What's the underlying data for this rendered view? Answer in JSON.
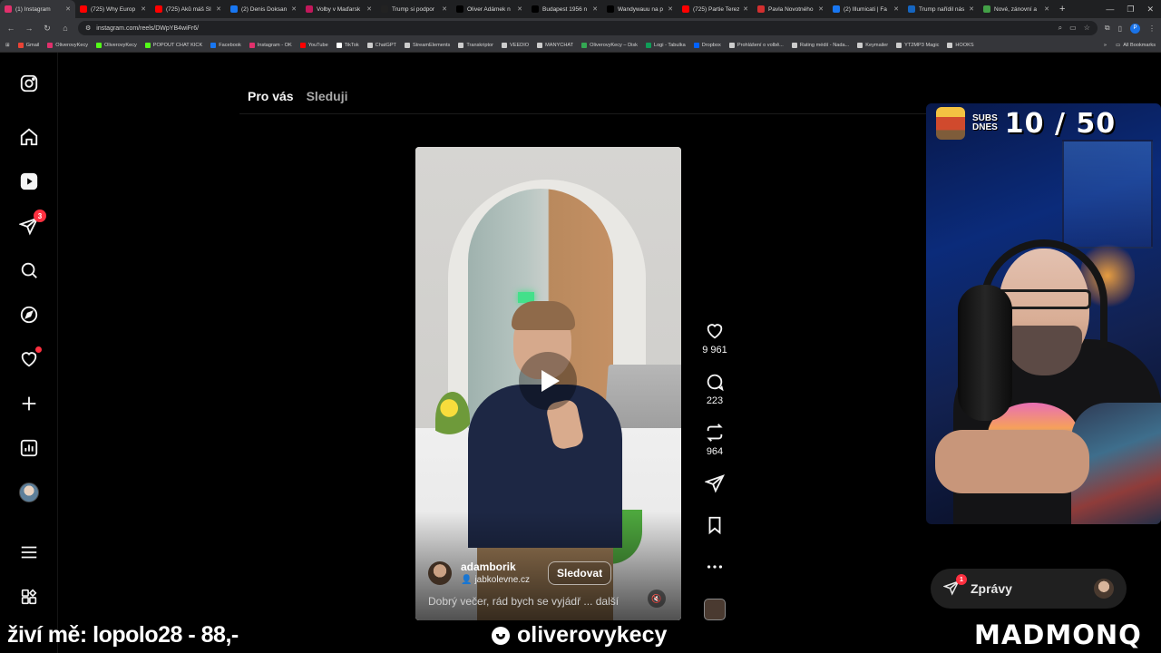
{
  "browser": {
    "tabs": [
      {
        "title": "(1) Instagram",
        "color": "#e1306c",
        "active": true
      },
      {
        "title": "(725) Why Europ",
        "color": "#ff0000"
      },
      {
        "title": "(725) Aků máš SI",
        "color": "#ff0000"
      },
      {
        "title": "(2) Denis Doksan",
        "color": "#1877f2"
      },
      {
        "title": "Volby v Maďarsk",
        "color": "#c2185b"
      },
      {
        "title": "Trump si podpor",
        "color": "#222222"
      },
      {
        "title": "Oliver Adámek n",
        "color": "#000000"
      },
      {
        "title": "Budapest 1956 n",
        "color": "#000000"
      },
      {
        "title": "Wandywauu na p",
        "color": "#000000"
      },
      {
        "title": "(725) Partie Terez",
        "color": "#ff0000"
      },
      {
        "title": "Pavla Novotného",
        "color": "#d32f2f"
      },
      {
        "title": "(2) Illumicati | Fa",
        "color": "#1877f2"
      },
      {
        "title": "Trump nařídil nás",
        "color": "#1565c0"
      },
      {
        "title": "Nové, zánovní a ",
        "color": "#43a047"
      }
    ],
    "new_tab": "+",
    "url": "instagram.com/reels/DWpYB4wiFr6/",
    "bookmarks": [
      {
        "label": "Gmail",
        "color": "#ea4335"
      },
      {
        "label": "OliverovyKecy",
        "color": "#e1306c"
      },
      {
        "label": "OliverovyKecy",
        "color": "#53fc18"
      },
      {
        "label": "POPOUT CHAT KICK",
        "color": "#53fc18"
      },
      {
        "label": "Facebook",
        "color": "#1877f2"
      },
      {
        "label": "Instagram - OK",
        "color": "#e1306c"
      },
      {
        "label": "YouTube",
        "color": "#ff0000"
      },
      {
        "label": "TikTok",
        "color": "#ffffff"
      },
      {
        "label": "ChatGPT",
        "color": "#cccccc"
      },
      {
        "label": "StreamElements",
        "color": "#cccccc"
      },
      {
        "label": "Transkriptor",
        "color": "#cccccc"
      },
      {
        "label": "VEEDIO",
        "color": "#cccccc"
      },
      {
        "label": "MANYCHAT",
        "color": "#cccccc"
      },
      {
        "label": "OliverovyKecy – Disk",
        "color": "#34a853"
      },
      {
        "label": "Logi - Tabulka",
        "color": "#0f9d58"
      },
      {
        "label": "Dropbox",
        "color": "#0061ff"
      },
      {
        "label": "Prohlášení o volbě...",
        "color": "#cccccc"
      },
      {
        "label": "Rating médií - Nada...",
        "color": "#cccccc"
      },
      {
        "label": "Keymailer",
        "color": "#cccccc"
      },
      {
        "label": "YT2MP3 Magic",
        "color": "#cccccc"
      },
      {
        "label": "HOOKS",
        "color": "#cccccc"
      }
    ],
    "all_bookmarks": "All Bookmarks"
  },
  "instagram": {
    "sidebar": {
      "messages_badge": "3"
    },
    "feed_tabs": {
      "for_you": "Pro vás",
      "following": "Sleduji"
    },
    "reel": {
      "author": "adamborik",
      "audio_label": "jabkolevne.cz",
      "follow_label": "Sledovat",
      "caption": "Dobrý večer, rád bych se vyjádř",
      "more_label": "... další",
      "likes": "9 961",
      "comments": "223",
      "reposts": "964"
    },
    "messages": {
      "label": "Zprávy",
      "badge": "1"
    }
  },
  "stream_overlay": {
    "subs_label_1": "SUBS",
    "subs_label_2": "DNES",
    "subs_count": "10 / 50",
    "donation": "živí mě: lopolo28 - 88,-",
    "channel": "oliverovykecy",
    "brand": "MADMONQ"
  }
}
